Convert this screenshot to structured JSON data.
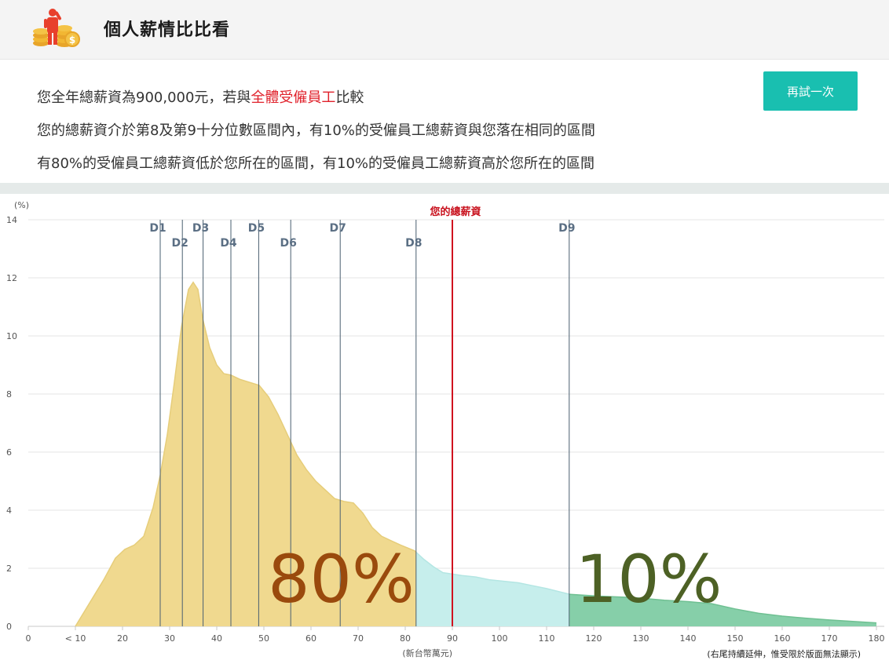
{
  "header": {
    "title": "個人薪情比比看"
  },
  "summary": {
    "line1_pre": "您全年總薪資為900,000元，若與",
    "line1_highlight": "全體受僱員工",
    "line1_post": "比較",
    "line2": "您的總薪資介於第8及第9十分位數區間內，有10%的受僱員工總薪資與您落在相同的區間",
    "line3": "有80%的受僱員工總薪資低於您所在的區間，有10%的受僱員工總薪資高於您所在的區間"
  },
  "retry_label": "再試一次",
  "colors": {
    "accent": "#19bfb0",
    "highlight": "#e0212b",
    "below": "#f0d98f",
    "same": "#c6eeec",
    "above": "#86cfa9"
  },
  "chart_data": {
    "type": "area",
    "title": "",
    "ylabel": "(%)",
    "xlabel": "(新台幣萬元)",
    "xlim": [
      0,
      180
    ],
    "ylim": [
      0,
      14
    ],
    "yticks": [
      0,
      2,
      4,
      6,
      8,
      10,
      12,
      14
    ],
    "xtick_values": [
      0,
      10,
      20,
      30,
      40,
      50,
      60,
      70,
      80,
      90,
      100,
      110,
      120,
      130,
      140,
      150,
      160,
      170,
      180
    ],
    "xtick_labels": [
      "0",
      "< 10",
      "20",
      "30",
      "40",
      "50",
      "60",
      "70",
      "80",
      "90",
      "100",
      "110",
      "120",
      "130",
      "140",
      "150",
      "160",
      "170",
      "180"
    ],
    "density_points": [
      [
        10,
        0
      ],
      [
        13,
        0.8
      ],
      [
        16,
        1.6
      ],
      [
        18.5,
        2.35
      ],
      [
        20.5,
        2.65
      ],
      [
        22.5,
        2.8
      ],
      [
        24.5,
        3.1
      ],
      [
        26.5,
        4.1
      ],
      [
        28,
        5.2
      ],
      [
        29.5,
        6.6
      ],
      [
        31,
        8.4
      ],
      [
        32.5,
        10.3
      ],
      [
        34,
        11.6
      ],
      [
        35,
        11.85
      ],
      [
        36,
        11.6
      ],
      [
        37,
        10.6
      ],
      [
        38.5,
        9.6
      ],
      [
        40,
        9.0
      ],
      [
        41.5,
        8.7
      ],
      [
        43,
        8.65
      ],
      [
        45,
        8.5
      ],
      [
        47,
        8.4
      ],
      [
        49,
        8.3
      ],
      [
        51,
        7.9
      ],
      [
        53,
        7.3
      ],
      [
        55,
        6.6
      ],
      [
        57,
        5.9
      ],
      [
        59,
        5.4
      ],
      [
        61,
        5.0
      ],
      [
        63,
        4.7
      ],
      [
        65,
        4.4
      ],
      [
        67,
        4.3
      ],
      [
        69,
        4.25
      ],
      [
        71,
        3.9
      ],
      [
        73,
        3.4
      ],
      [
        75,
        3.1
      ],
      [
        77,
        2.95
      ],
      [
        79,
        2.8
      ],
      [
        82,
        2.6
      ],
      [
        84,
        2.3
      ],
      [
        86,
        2.05
      ],
      [
        88,
        1.85
      ],
      [
        90,
        1.8
      ],
      [
        92,
        1.75
      ],
      [
        95,
        1.7
      ],
      [
        98,
        1.6
      ],
      [
        101,
        1.55
      ],
      [
        104,
        1.5
      ],
      [
        107,
        1.4
      ],
      [
        110,
        1.3
      ],
      [
        113,
        1.18
      ],
      [
        115,
        1.1
      ],
      [
        118,
        1.07
      ],
      [
        121,
        1.04
      ],
      [
        124,
        1.02
      ],
      [
        127,
        1.0
      ],
      [
        130,
        0.97
      ],
      [
        135,
        0.9
      ],
      [
        140,
        0.85
      ],
      [
        145,
        0.78
      ],
      [
        150,
        0.6
      ],
      [
        155,
        0.45
      ],
      [
        160,
        0.35
      ],
      [
        165,
        0.28
      ],
      [
        170,
        0.22
      ],
      [
        175,
        0.17
      ],
      [
        180,
        0.12
      ]
    ],
    "deciles": [
      {
        "label": "D1",
        "x": 28.0
      },
      {
        "label": "D2",
        "x": 32.7
      },
      {
        "label": "D3",
        "x": 37.1
      },
      {
        "label": "D4",
        "x": 43.0
      },
      {
        "label": "D5",
        "x": 48.9
      },
      {
        "label": "D6",
        "x": 55.7
      },
      {
        "label": "D7",
        "x": 66.2
      },
      {
        "label": "D8",
        "x": 82.3
      },
      {
        "label": "D9",
        "x": 114.8
      }
    ],
    "user_salary": {
      "label": "您的總薪資",
      "x": 90
    },
    "regions": [
      {
        "name": "below",
        "from": 10,
        "to": 82.3,
        "color": "#f0d98f",
        "stroke": "#e6cd7a"
      },
      {
        "name": "same",
        "from": 82.3,
        "to": 114.8,
        "color": "#c6eeec",
        "stroke": "#b4e6e3"
      },
      {
        "name": "above",
        "from": 114.8,
        "to": 180,
        "color": "#86cfa9",
        "stroke": "#6fc092"
      }
    ],
    "annotations": [
      {
        "text": "80%",
        "color": "#9a4a0d"
      },
      {
        "text": "10%",
        "color": "#4d6125"
      }
    ],
    "footnote": "(右尾持續延伸，惟受限於版面無法顯示)"
  }
}
